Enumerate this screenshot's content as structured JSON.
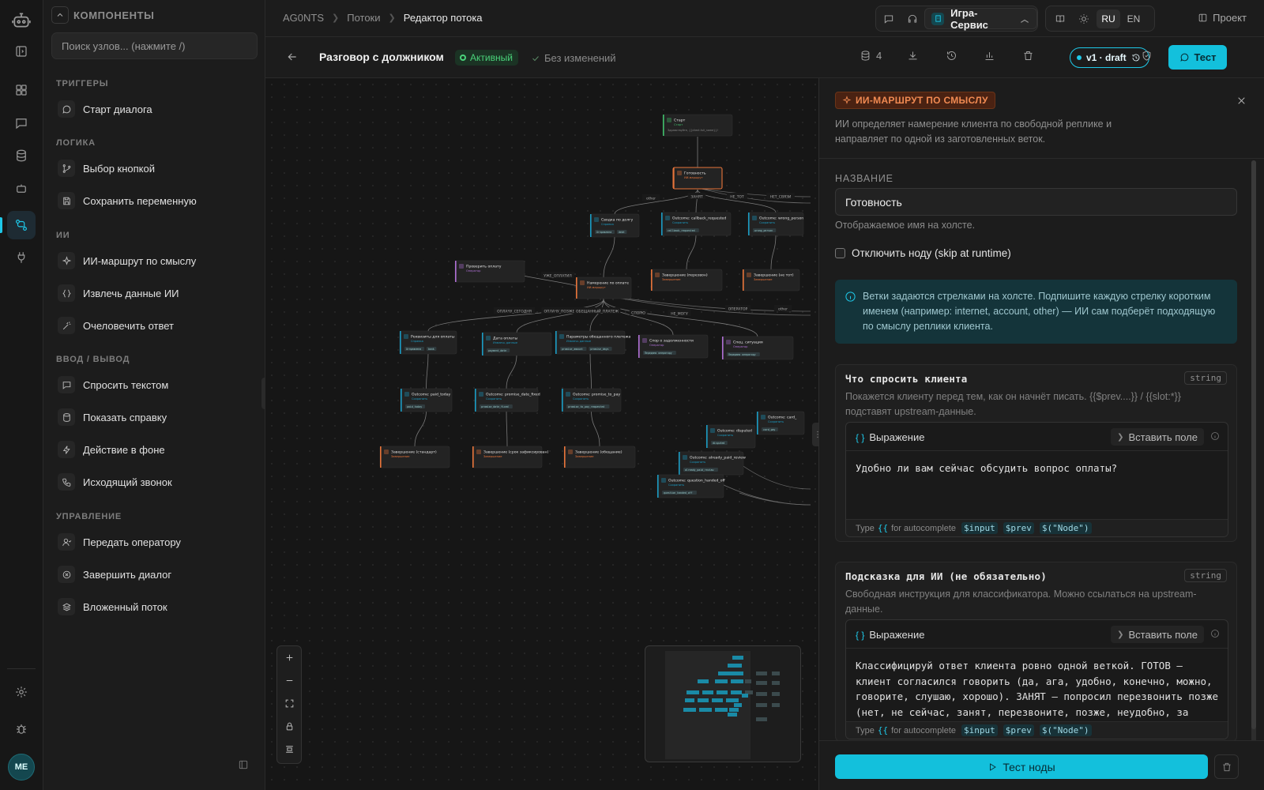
{
  "rail": {
    "items": [
      "robot-logo-icon",
      "sidebar-toggle-icon",
      "dashboard-icon",
      "chat-icon",
      "database-icon",
      "bot-icon",
      "flows-icon",
      "plug-icon",
      "settings-icon",
      "bug-icon"
    ],
    "avatar": "ME"
  },
  "components": {
    "title": "КОМПОНЕНТЫ",
    "search_placeholder": "Поиск узлов... (нажмите /)",
    "groups": [
      {
        "title": "ТРИГГЕРЫ",
        "items": [
          "Старт диалога"
        ]
      },
      {
        "title": "ЛОГИКА",
        "items": [
          "Выбор кнопкой",
          "Сохранить переменную"
        ]
      },
      {
        "title": "ИИ",
        "items": [
          "ИИ-маршрут по смыслу",
          "Извлечь данные ИИ",
          "Очеловечить ответ"
        ]
      },
      {
        "title": "ВВОД / ВЫВОД",
        "items": [
          "Спросить текстом",
          "Показать справку",
          "Действие в фоне",
          "Исходящий звонок"
        ]
      },
      {
        "title": "УПРАВЛЕНИЕ",
        "items": [
          "Передать оператору",
          "Завершить диалог",
          "Вложенный поток"
        ]
      }
    ]
  },
  "topbar": {
    "breadcrumbs": [
      "AG0NTS",
      "Потоки",
      "Редактор потока"
    ],
    "workspace": "Игра-Сервис",
    "lang_ru": "RU",
    "lang_en": "EN",
    "project": "Проект"
  },
  "flow": {
    "title": "Разговор с должником",
    "status": "Активный",
    "saved": "Без изменений",
    "db_count": "4",
    "version": "v1 · draft",
    "test": "Тест"
  },
  "canvas": {
    "nodes": [
      {
        "id": "start",
        "title": "Старт",
        "sub": "Старт",
        "desc": "Здравствуйте, {{client.full_name}}!",
        "kind": "start"
      },
      {
        "id": "ready",
        "title": "Готовность",
        "sub": "ИИ-маршрут",
        "kind": "ai"
      },
      {
        "id": "debt",
        "title": "Сводка по долгу",
        "sub": "Справка",
        "kind": "io",
        "tags": [
          "Отправлена",
          "debt"
        ]
      },
      {
        "id": "cb",
        "title": "Outcome: callback_requested",
        "sub": "Сохранить",
        "kind": "io",
        "tags": [
          "callback_requested"
        ]
      },
      {
        "id": "wp",
        "title": "Outcome: wrong_person",
        "sub": "Сохранить",
        "kind": "io",
        "tags": [
          "wrong_person"
        ]
      },
      {
        "id": "endcb",
        "title": "Завершение (перезвон)",
        "sub": "Завершение",
        "kind": "end"
      },
      {
        "id": "endwp",
        "title": "Завершение (не тот)",
        "sub": "Завершение",
        "kind": "end"
      },
      {
        "id": "check",
        "title": "Проверить оплату",
        "sub": "Оператор",
        "kind": "op"
      },
      {
        "id": "intent",
        "title": "Намерение по оплате",
        "sub": "ИИ-маршрут",
        "kind": "ai"
      },
      {
        "id": "req",
        "title": "Реквизиты для оплаты",
        "sub": "Справка",
        "kind": "io",
        "tags": [
          "Отправлена",
          "bank"
        ]
      },
      {
        "id": "date",
        "title": "Дата оплаты",
        "sub": "Извлечь данные",
        "kind": "io",
        "tags": [
          "payment_date"
        ]
      },
      {
        "id": "params",
        "title": "Параметры обещанного платежа",
        "sub": "Извлечь данные",
        "kind": "io",
        "tags": [
          "promise_amount",
          "promise_days"
        ]
      },
      {
        "id": "dispute",
        "title": "Спор о задолженности",
        "sub": "Оператор",
        "kind": "op",
        "tags": [
          "Передано оператору"
        ]
      },
      {
        "id": "hard",
        "title": "Спец. ситуация",
        "sub": "Оператор",
        "kind": "op",
        "tags": [
          "Передано оператору"
        ]
      },
      {
        "id": "o1",
        "title": "Outcome: paid_today",
        "sub": "Сохранить",
        "kind": "io",
        "tags": [
          "paid_today"
        ]
      },
      {
        "id": "o2",
        "title": "Outcome: promise_date_fixed",
        "sub": "Сохранить",
        "kind": "io",
        "tags": [
          "promise_date_fixed"
        ]
      },
      {
        "id": "o3",
        "title": "Outcome: promise_to_pay",
        "sub": "Сохранить",
        "kind": "io",
        "tags": [
          "promise_to_pay_requested"
        ]
      },
      {
        "id": "e1",
        "title": "Завершение (стандарт)",
        "sub": "Завершение",
        "kind": "end"
      },
      {
        "id": "e2",
        "title": "Завершение (срок зафиксирован)",
        "sub": "Завершение",
        "kind": "end"
      },
      {
        "id": "e3",
        "title": "Завершение (обещание)",
        "sub": "Завершение",
        "kind": "end"
      },
      {
        "id": "o4",
        "title": "Outcome: disputed",
        "sub": "Сохранить",
        "kind": "io",
        "tags": [
          "disputed"
        ]
      },
      {
        "id": "o5",
        "title": "Outcome: card_",
        "sub": "Сохранить",
        "kind": "io",
        "tags": [
          "card_pay"
        ]
      },
      {
        "id": "o6",
        "title": "Outcome: already_paid_review",
        "sub": "Сохранить",
        "kind": "io",
        "tags": [
          "already_paid_review"
        ]
      },
      {
        "id": "o7",
        "title": "Outcome: question_handed_off",
        "sub": "Сохранить",
        "kind": "io",
        "tags": [
          "question_handed_off"
        ]
      }
    ],
    "edge_labels": [
      "other",
      "ЗАНЯТ",
      "НЕ_ТОТ",
      "НЕТ_СВЯЗИ",
      "УЖЕ_ОПЛАТИЛ",
      "ОПЛАЧУ_СЕГОДНЯ",
      "ОПЛАЧУ_ПОЗЖЕ",
      "ОБЕЩАННЫЙ_ПЛАТЕЖ",
      "СПОРЮ",
      "НЕ_МОГУ",
      "ОПЕРАТОР",
      "other"
    ]
  },
  "inspector": {
    "badge": "ИИ-МАРШРУТ ПО СМЫСЛУ",
    "description": "ИИ определяет намерение клиента по свободной реплике и направляет по одной из заготовленных веток.",
    "name_label": "НАЗВАНИЕ",
    "name_value": "Готовность",
    "name_hint": "Отображаемое имя на холсте.",
    "disable_label": "Отключить ноду (skip at runtime)",
    "info": "Ветки задаются стрелками на холсте. Подпишите каждую стрелку коротким именем (например: internet, account, other) — ИИ сам подберёт подходящую по смыслу реплики клиента.",
    "field1": {
      "title": "Что спросить клиента",
      "type": "string",
      "description": "Покажется клиенту перед тем, как он начнёт писать. {{$prev....}} / {{slot:*}} подставят upstream-данные.",
      "mode": "Выражение",
      "insert": "Вставить поле",
      "value": "Удобно ли вам сейчас обсудить вопрос оплаты?"
    },
    "field2": {
      "title": "Подсказка для ИИ (не обязательно)",
      "type": "string",
      "description": "Свободная инструкция для классификатора. Можно ссылаться на upstream-данные.",
      "mode": "Выражение",
      "insert": "Вставить поле",
      "value": "Классифицируй ответ клиента ровно одной веткой. ГОТОВ — клиент согласился говорить (да, ага, удобно, конечно, можно, говорите, слушаю, хорошо). ЗАНЯТ — попросил перезвонить позже (нет, не сейчас, занят, перезвоните, позже, неудобно, за рулём, на"
    },
    "foot_type": "Type",
    "foot_brace": "{{",
    "foot_text": "for autocomplete",
    "foot_tokens": [
      "$input",
      "$prev",
      "$(\"Node\")"
    ],
    "test_node": "Тест ноды"
  },
  "colors": {
    "accent": "#13c0dc",
    "ai": "#f08a52",
    "active": "#4ad27a"
  }
}
